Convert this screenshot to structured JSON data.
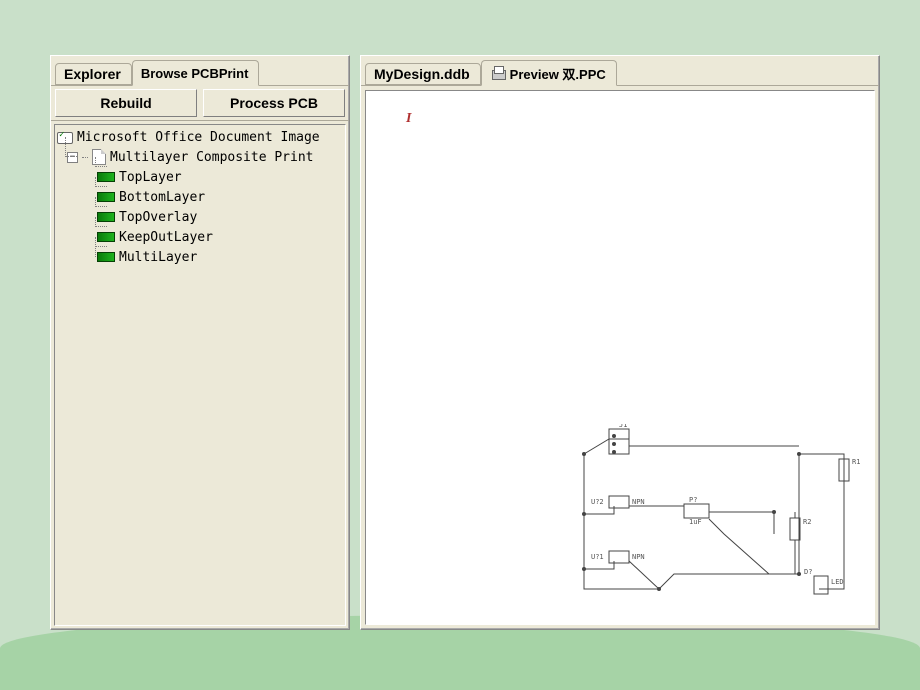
{
  "leftPanel": {
    "tabs": {
      "explorer": "Explorer",
      "browse": "Browse PCBPrint"
    },
    "buttons": {
      "rebuild": "Rebuild",
      "process": "Process PCB"
    },
    "tree": {
      "root": "Microsoft Office Document Image",
      "composite": "Multilayer Composite Print",
      "layers": [
        "TopLayer",
        "BottomLayer",
        "TopOverlay",
        "KeepOutLayer",
        "MultiLayer"
      ]
    }
  },
  "rightPanel": {
    "tabs": {
      "ddb": "MyDesign.ddb",
      "preview": "Preview 双.PPC"
    },
    "marker": "I"
  },
  "pcb": {
    "labels": {
      "j1": "J1",
      "r1": "R1",
      "u2": "U?2",
      "u1": "U?1",
      "npn1": "NPN",
      "npn2": "NPN",
      "p1": "P?",
      "uf": "1uF",
      "r2": "R2",
      "d1": "D?",
      "led": "LED"
    }
  }
}
